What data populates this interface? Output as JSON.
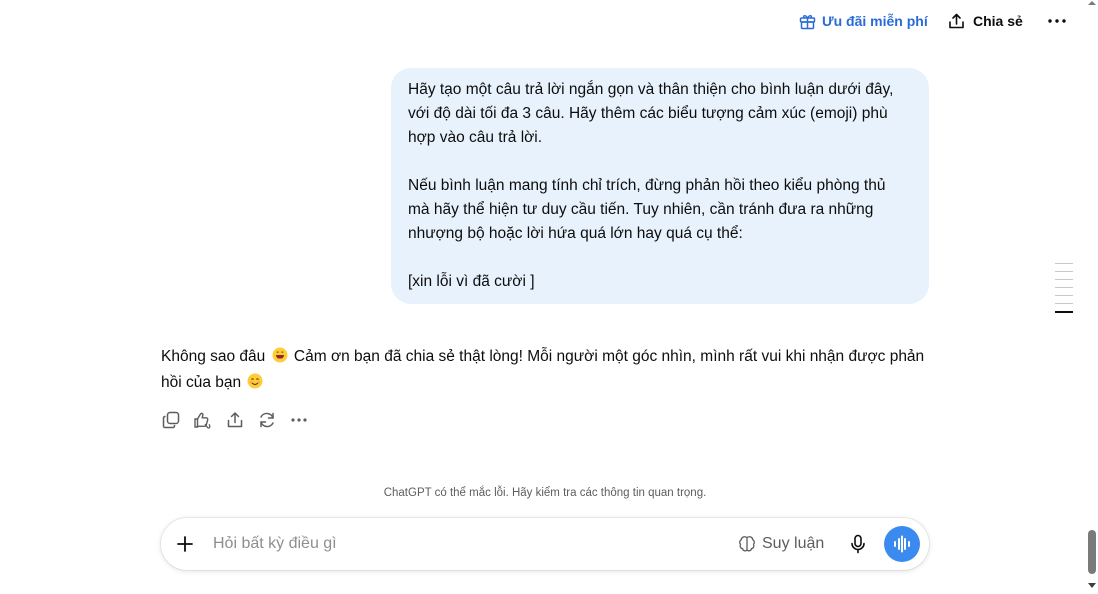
{
  "header": {
    "offer_label": "Ưu đãi miễn phí",
    "share_label": "Chia sẻ",
    "offer_color": "#2b6bd6"
  },
  "user_message": {
    "para1": "Hãy tạo một câu trả lời ngắn gọn và thân thiện cho bình luận dưới đây,\nvới độ dài tối đa 3 câu. Hãy thêm các biểu tượng cảm xúc (emoji) phù\nhợp vào câu trả lời.",
    "para2": "Nếu bình luận mang tính chỉ trích, đừng phản hồi theo kiểu phòng thủ\nmà hãy thể hiện tư duy cầu tiến. Tuy nhiên, cần tránh đưa ra những\nnhượng bộ hoặc lời hứa quá lớn hay quá cụ thể:",
    "para3": "[xin lỗi vì đã cười ]",
    "bubble_color": "#e8f2fd"
  },
  "assistant_message": {
    "part1": "Không sao đâu",
    "part2": "Cảm ơn bạn đã chia sẻ thật lòng! Mỗi người một góc nhìn, mình rất vui khi nhận được phản hồi của bạn",
    "actions": [
      "copy-icon",
      "feedback-icon",
      "share-icon",
      "regenerate-icon",
      "more-icon"
    ]
  },
  "footer": {
    "disclaimer": "ChatGPT có thể mắc lỗi. Hãy kiểm tra các thông tin quan trọng."
  },
  "composer": {
    "placeholder": "Hỏi bất kỳ điều gì",
    "reason_label": "Suy luận",
    "voice_color": "#3b8af0"
  }
}
